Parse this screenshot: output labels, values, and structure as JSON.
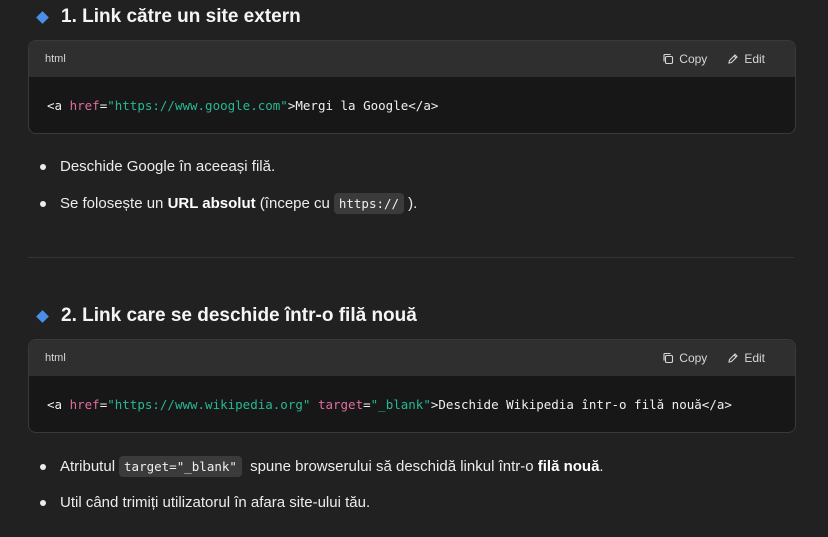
{
  "section1": {
    "heading": "1. Link către un site extern",
    "code_lang": "html",
    "copy_label": "Copy",
    "edit_label": "Edit",
    "code": {
      "open_tag": "<a ",
      "attr1": "href",
      "eq1": "=",
      "val1": "\"https://www.google.com\"",
      "close_open": ">",
      "text": "Mergi la Google",
      "close_tag": "</a>"
    },
    "bullets": [
      {
        "text": "Deschide Google în aceeași filă."
      },
      {
        "before": "Se folosește un ",
        "bold": "URL absolut",
        "middle": " (începe cu",
        "code": "https://",
        "after": ")."
      }
    ]
  },
  "section2": {
    "heading": "2. Link care se deschide într-o filă nouă",
    "code_lang": "html",
    "copy_label": "Copy",
    "edit_label": "Edit",
    "code": {
      "open_tag": "<a ",
      "attr1": "href",
      "eq1": "=",
      "val1": "\"https://www.wikipedia.org\"",
      "space": " ",
      "attr2": "target",
      "eq2": "=",
      "val2": "\"_blank\"",
      "close_open": ">",
      "text": "Deschide Wikipedia într-o filă nouă",
      "close_tag": "</a>"
    },
    "bullets": [
      {
        "before": "Atributul",
        "code": "target=\"_blank\"",
        "middle": " spune browserului să deschidă linkul într-o ",
        "bold": "filă nouă",
        "after": "."
      },
      {
        "text": "Util când trimiți utilizatorul în afara site-ului tău."
      }
    ]
  },
  "colors": {
    "background": "#212121",
    "code_header": "#2f2f2f",
    "code_body": "#171717",
    "diamond": "#4a8ee8",
    "attr": "#e06c9f",
    "string": "#26b894"
  }
}
